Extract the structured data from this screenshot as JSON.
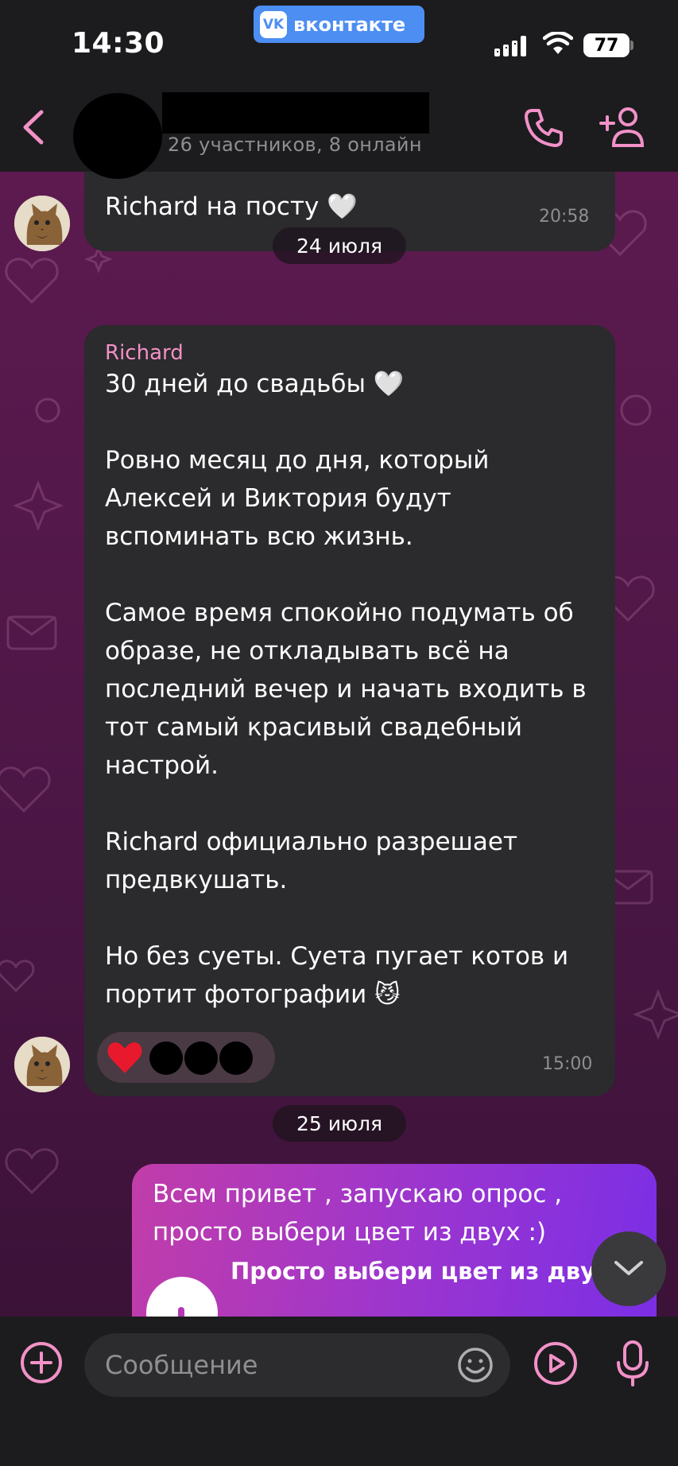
{
  "status_bar": {
    "time": "14:30",
    "vk_label": "вконтакте",
    "vk_logo": "VK",
    "battery": "77"
  },
  "header": {
    "subtitle": "26 участников, 8 онлайн"
  },
  "messages": [
    {
      "text": "Richard на посту 🤍",
      "time": "20:58"
    },
    {
      "sender": "Richard",
      "text": "30 дней до свадьбы 🤍\n\nРовно месяц до дня, который Алексей и Виктория будут вспоминать всю жизнь.\n\nСамое время спокойно подумать об образе, не откладывать всё на последний вечер и начать входить в тот самый красивый свадебный настрой.\n\nRichard официально разрешает предвкушать.\n\nНо без суеты. Суета пугает котов и портит фотографии 😼",
      "time": "15:00",
      "reaction": "❤️"
    },
    {
      "text": "Всем привет , запускаю опрос , просто выбери цвет из двух :)",
      "poll_title": "Просто выбери цвет из двух"
    }
  ],
  "dates": [
    "24 июля",
    "25 июля"
  ],
  "composer": {
    "placeholder": "Сообщение"
  },
  "colors": {
    "accent": "#f291c8",
    "bubble_in": "#2b2a2c",
    "bubble_out_start": "#c13da9",
    "bubble_out_end": "#7a2ee6"
  },
  "icons": [
    "back-icon",
    "phone-icon",
    "add-user-icon",
    "plus-icon",
    "emoji-icon",
    "video-message-icon",
    "microphone-icon",
    "chevron-down-icon",
    "signal-icon",
    "wifi-icon"
  ]
}
